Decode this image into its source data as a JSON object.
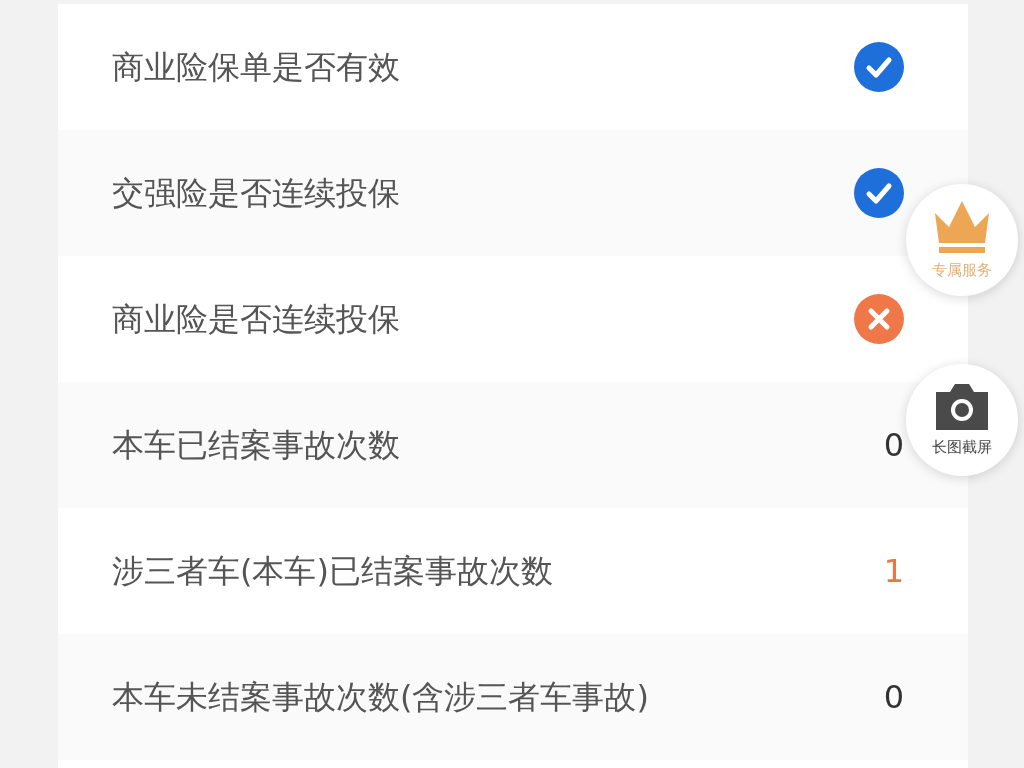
{
  "rows": [
    {
      "label": "商业险保单是否有效",
      "kind": "check",
      "passed": true
    },
    {
      "label": "交强险是否连续投保",
      "kind": "check",
      "passed": true
    },
    {
      "label": "商业险是否连续投保",
      "kind": "check",
      "passed": false
    },
    {
      "label": "本车已结案事故次数",
      "kind": "count",
      "value": "0",
      "alert": false
    },
    {
      "label": "涉三者车(本车)已结案事故次数",
      "kind": "count",
      "value": "1",
      "alert": true
    },
    {
      "label": "本车未结案事故次数(含涉三者车事故)",
      "kind": "count",
      "value": "0",
      "alert": false
    }
  ],
  "floating_buttons": [
    {
      "kind": "crown",
      "label": "专属服务"
    },
    {
      "kind": "camera",
      "label": "长图截屏"
    }
  ]
}
